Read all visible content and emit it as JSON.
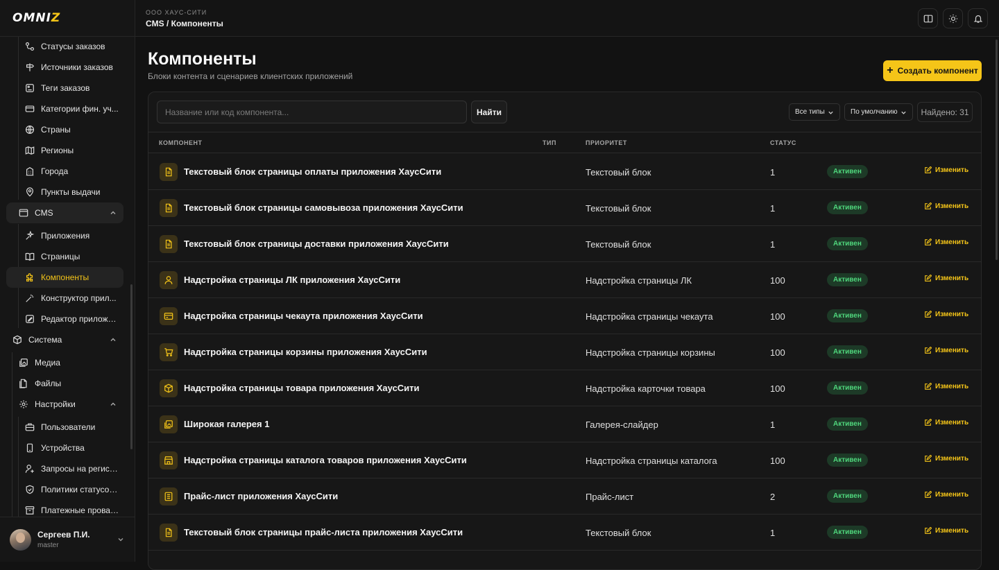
{
  "brand": {
    "logo_pre": "OMNI",
    "logo_post": "Z"
  },
  "sidebar": {
    "items": [
      {
        "label": "Статусы заказов",
        "icon": "status-icon"
      },
      {
        "label": "Источники заказов",
        "icon": "signpost-icon"
      },
      {
        "label": "Теги заказов",
        "icon": "tag-icon"
      },
      {
        "label": "Категории фин. уч...",
        "icon": "card-icon"
      },
      {
        "label": "Страны",
        "icon": "globe-icon"
      },
      {
        "label": "Регионы",
        "icon": "map-icon"
      },
      {
        "label": "Города",
        "icon": "building-icon"
      },
      {
        "label": "Пункты выдачи",
        "icon": "pin-icon"
      },
      {
        "label": "CMS",
        "icon": "window-icon"
      },
      {
        "label": "Приложения",
        "icon": "sparkle-icon"
      },
      {
        "label": "Страницы",
        "icon": "book-icon"
      },
      {
        "label": "Компоненты",
        "icon": "puzzle-icon"
      },
      {
        "label": "Конструктор прил...",
        "icon": "wand-icon"
      },
      {
        "label": "Редактор приложе...",
        "icon": "edit-icon"
      },
      {
        "label": "Система",
        "icon": "box-icon"
      },
      {
        "label": "Медиа",
        "icon": "media-icon"
      },
      {
        "label": "Файлы",
        "icon": "file-icon"
      },
      {
        "label": "Настройки",
        "icon": "gear-icon"
      },
      {
        "label": "Пользователи",
        "icon": "briefcase-icon"
      },
      {
        "label": "Устройства",
        "icon": "phone-icon"
      },
      {
        "label": "Запросы на регист...",
        "icon": "user-plus-icon"
      },
      {
        "label": "Политики статусов...",
        "icon": "shield-icon"
      },
      {
        "label": "Платежные провай...",
        "icon": "archive-icon"
      }
    ]
  },
  "user": {
    "name": "Сергеев П.И.",
    "role": "master"
  },
  "header": {
    "org": "ООО ХАУС-СИТИ",
    "breadcrumb": "CMS / Компоненты"
  },
  "page": {
    "title": "Компоненты",
    "subtitle": "Блоки контента и сценариев клиентских приложений",
    "create_label": "Создать компонент"
  },
  "filters": {
    "search_placeholder": "Название или код компонента...",
    "find_label": "Найти",
    "type_select": "Все типы",
    "sort_select": "По умолчанию",
    "found": "Найдено: 31"
  },
  "table": {
    "headers": {
      "component": "КОМПОНЕНТ",
      "type": "ТИП",
      "priority": "ПРИОРИТЕТ",
      "status": "СТАТУС"
    },
    "edit_label": "Изменить",
    "rows": [
      {
        "name": "Текстовый блок страницы оплаты приложения ХаусСити",
        "type": "Текстовый блок",
        "priority": "1",
        "status": "Активен",
        "icon": "document-icon"
      },
      {
        "name": "Текстовый блок страницы самовывоза приложения ХаусСити",
        "type": "Текстовый блок",
        "priority": "1",
        "status": "Активен",
        "icon": "document-icon"
      },
      {
        "name": "Текстовый блок страницы доставки приложения ХаусСити",
        "type": "Текстовый блок",
        "priority": "1",
        "status": "Активен",
        "icon": "document-icon"
      },
      {
        "name": "Надстройка страницы ЛК приложения ХаусСити",
        "type": "Надстройка страницы ЛК",
        "priority": "100",
        "status": "Активен",
        "icon": "user-icon"
      },
      {
        "name": "Надстройка страницы чекаута приложения ХаусСити",
        "type": "Надстройка страницы чекаута",
        "priority": "100",
        "status": "Активен",
        "icon": "wallet-icon"
      },
      {
        "name": "Надстройка страницы корзины приложения ХаусСити",
        "type": "Надстройка страницы корзины",
        "priority": "100",
        "status": "Активен",
        "icon": "cart-icon"
      },
      {
        "name": "Надстройка страницы товара приложения ХаусСити",
        "type": "Надстройка карточки товара",
        "priority": "100",
        "status": "Активен",
        "icon": "package-icon"
      },
      {
        "name": "Широкая галерея 1",
        "type": "Галерея-слайдер",
        "priority": "1",
        "status": "Активен",
        "icon": "gallery-icon"
      },
      {
        "name": "Надстройка страницы каталога товаров приложения ХаусСити",
        "type": "Надстройка страницы каталога",
        "priority": "100",
        "status": "Активен",
        "icon": "store-icon"
      },
      {
        "name": "Прайс-лист приложения ХаусСити",
        "type": "Прайс-лист",
        "priority": "2",
        "status": "Активен",
        "icon": "list-icon"
      },
      {
        "name": "Текстовый блок страницы прайс-листа приложения ХаусСити",
        "type": "Текстовый блок",
        "priority": "1",
        "status": "Активен",
        "icon": "document-icon"
      }
    ]
  },
  "colors": {
    "accent": "#f5c518",
    "status_bg": "#1d3a27",
    "status_text": "#4fd67c"
  }
}
